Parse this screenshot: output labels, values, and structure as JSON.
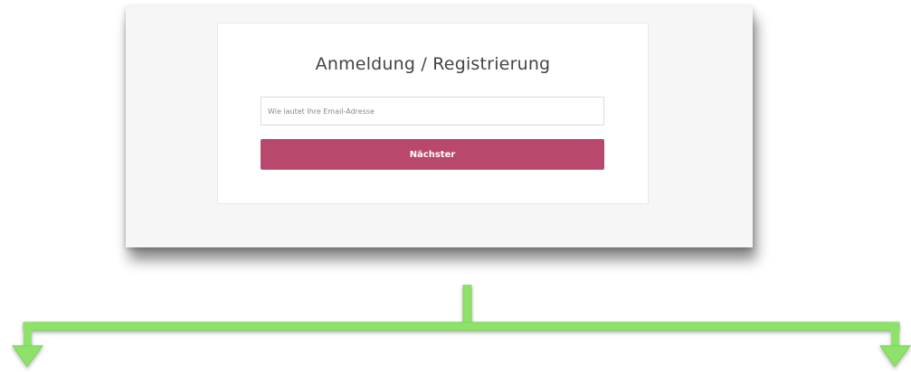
{
  "login_card": {
    "title": "Anmeldung / Registrierung",
    "email_placeholder": "Wie lautet Ihre Email-Adresse",
    "email_value": "",
    "next_button_label": "Nächster"
  },
  "colors": {
    "button_accent": "#b8496d",
    "arrow_green": "#8ee26a",
    "frame_background": "#f6f6f6"
  },
  "decorations": {
    "connector": "down-arrow-split-left-right"
  }
}
